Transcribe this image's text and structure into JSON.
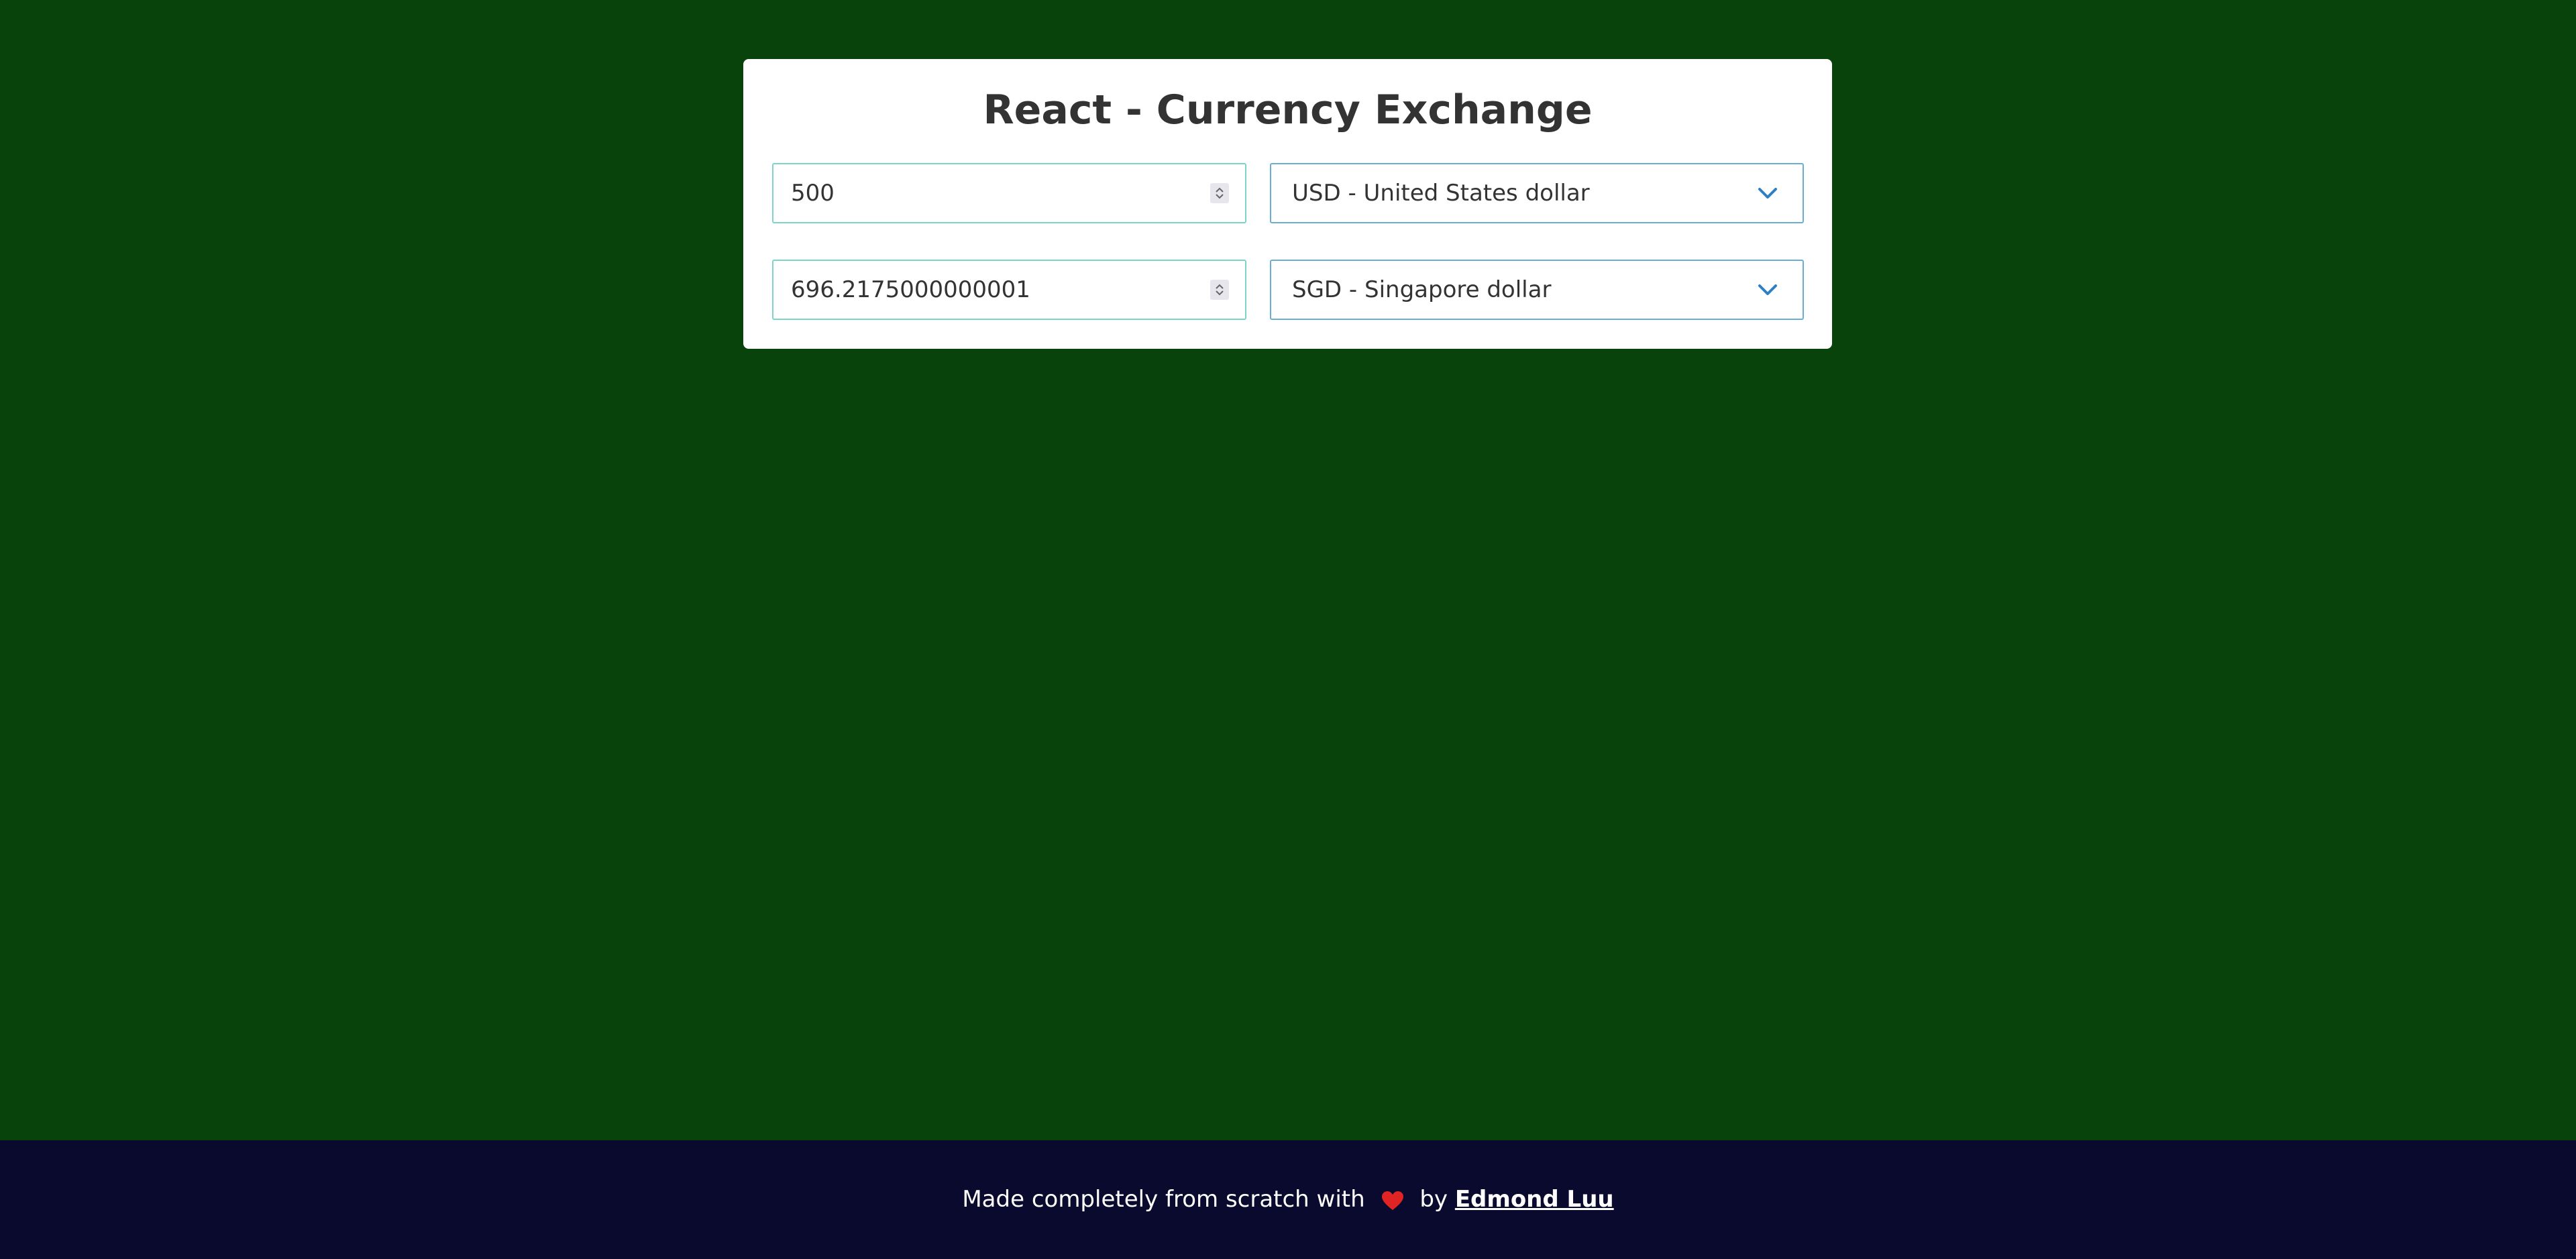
{
  "app": {
    "title": "React - Currency Exchange"
  },
  "converter": {
    "from": {
      "amount": "500",
      "currency": "USD - United States dollar"
    },
    "to": {
      "amount": "696.2175000000001",
      "currency": "SGD - Singapore dollar"
    }
  },
  "footer": {
    "prefix": "Made completely from scratch with",
    "heart_icon": "heart-icon",
    "by": "by",
    "author": "Edmond Luu"
  },
  "colors": {
    "background": "#07430a",
    "card": "#ffffff",
    "footer": "#0a0a2e",
    "heart": "#e02424",
    "input_border": "#7fd4c8",
    "select_border": "#6aaed6"
  }
}
